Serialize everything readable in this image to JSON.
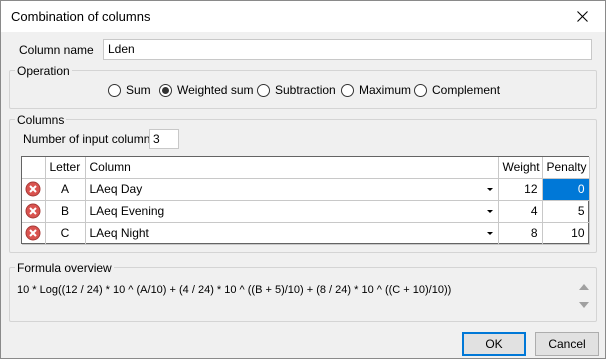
{
  "dialog": {
    "title": "Combination of columns"
  },
  "column_name": {
    "label": "Column name",
    "value": "Lden"
  },
  "operation": {
    "title": "Operation",
    "options": [
      {
        "label": "Sum",
        "checked": false
      },
      {
        "label": "Weighted sum",
        "checked": true
      },
      {
        "label": "Subtraction",
        "checked": false
      },
      {
        "label": "Maximum",
        "checked": false
      },
      {
        "label": "Complement",
        "checked": false
      }
    ]
  },
  "columns": {
    "title": "Columns",
    "input_count_label": "Number of input columns",
    "input_count_value": "3",
    "headers": {
      "letter": "Letter",
      "column": "Column",
      "weight": "Weight",
      "penalty": "Penalty"
    },
    "rows": [
      {
        "letter": "A",
        "column": "LAeq Day",
        "weight": "12",
        "penalty": "0"
      },
      {
        "letter": "B",
        "column": "LAeq Evening",
        "weight": "4",
        "penalty": "5"
      },
      {
        "letter": "C",
        "column": "LAeq Night",
        "weight": "8",
        "penalty": "10"
      }
    ]
  },
  "formula": {
    "title": "Formula overview",
    "text": "10 * Log((12 / 24) * 10 ^ (A/10) + (4 / 24) * 10 ^ ((B + 5)/10) + (8 / 24) * 10 ^ ((C + 10)/10))"
  },
  "buttons": {
    "ok": "OK",
    "cancel": "Cancel"
  },
  "colors": {
    "selection": "#0078d7",
    "delete_icon": "#d9534f"
  }
}
